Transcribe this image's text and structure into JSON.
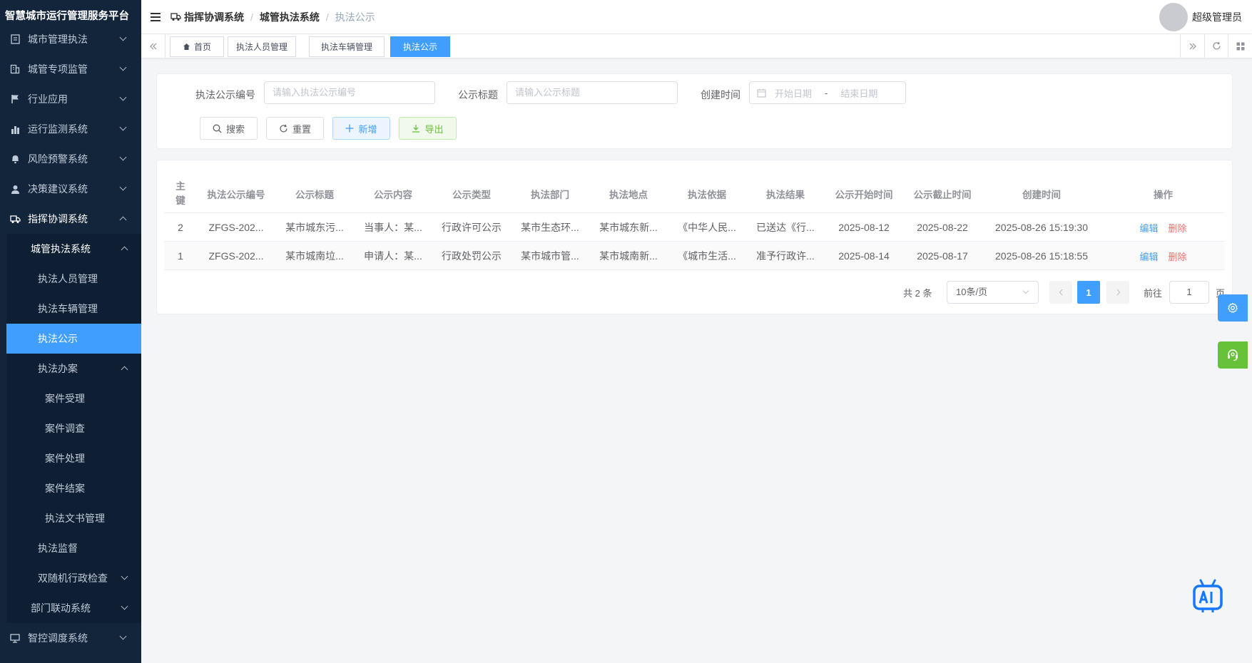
{
  "app": {
    "title": "智慧城市运行管理服务平台"
  },
  "sidebar": {
    "items": [
      {
        "label": "城市管理执法",
        "icon": "document-icon"
      },
      {
        "label": "城管专项监管",
        "icon": "building-icon"
      },
      {
        "label": "行业应用",
        "icon": "flag-icon"
      },
      {
        "label": "运行监测系统",
        "icon": "bar-chart-icon"
      },
      {
        "label": "风险预警系统",
        "icon": "bell-icon"
      },
      {
        "label": "决策建议系统",
        "icon": "user-icon"
      },
      {
        "label": "指挥协调系统",
        "icon": "truck-icon"
      }
    ],
    "sub": {
      "group": "城管执法系统",
      "items": [
        "执法人员管理",
        "执法车辆管理",
        "执法公示"
      ],
      "case_group": "执法办案",
      "case_items": [
        "案件受理",
        "案件调查",
        "案件处理",
        "案件结案",
        "执法文书管理"
      ],
      "supervise": "执法监督",
      "random": "双随机行政检查",
      "linkage": "部门联动系统"
    },
    "bottom": {
      "label": "智控调度系统",
      "icon": "monitor-icon"
    }
  },
  "header": {
    "breadcrumb": [
      "指挥协调系统",
      "城管执法系统",
      "执法公示"
    ],
    "user": "超级管理员"
  },
  "tags": [
    "首页",
    "执法人员管理",
    "执法车辆管理",
    "执法公示"
  ],
  "search": {
    "code_label": "执法公示编号",
    "code_placeholder": "请输入执法公示编号",
    "title_label": "公示标题",
    "title_placeholder": "请输入公示标题",
    "time_label": "创建时间",
    "start_placeholder": "开始日期",
    "range_sep": "-",
    "end_placeholder": "结束日期",
    "btn_search": "搜索",
    "btn_reset": "重置",
    "btn_add": "新增",
    "btn_export": "导出"
  },
  "table": {
    "headers": [
      "主键",
      "执法公示编号",
      "公示标题",
      "公示内容",
      "公示类型",
      "执法部门",
      "执法地点",
      "执法依据",
      "执法结果",
      "公示开始时间",
      "公示截止时间",
      "创建时间",
      "操作"
    ],
    "rows": [
      [
        "2",
        "ZFGS-202...",
        "某市城东污...",
        "当事人：某...",
        "行政许可公示",
        "某市生态环...",
        "某市城东新...",
        "《中华人民...",
        "已送达《行...",
        "2025-08-12",
        "2025-08-22",
        "2025-08-26 15:19:30"
      ],
      [
        "1",
        "ZFGS-202...",
        "某市城南垃...",
        "申请人：某...",
        "行政处罚公示",
        "某市城市管...",
        "某市城南新...",
        "《城市生活...",
        "准予行政许...",
        "2025-08-14",
        "2025-08-17",
        "2025-08-26 15:18:55"
      ]
    ],
    "action_edit": "编辑",
    "action_delete": "删除"
  },
  "pagination": {
    "total": "共 2 条",
    "page_size": "10条/页",
    "current": "1",
    "goto_label": "前往",
    "goto_value": "1",
    "page_unit": "页"
  },
  "colors": {
    "primary": "#409eff",
    "sidebar": "#13253a",
    "success": "#67c23a",
    "danger": "#f56c6c"
  }
}
